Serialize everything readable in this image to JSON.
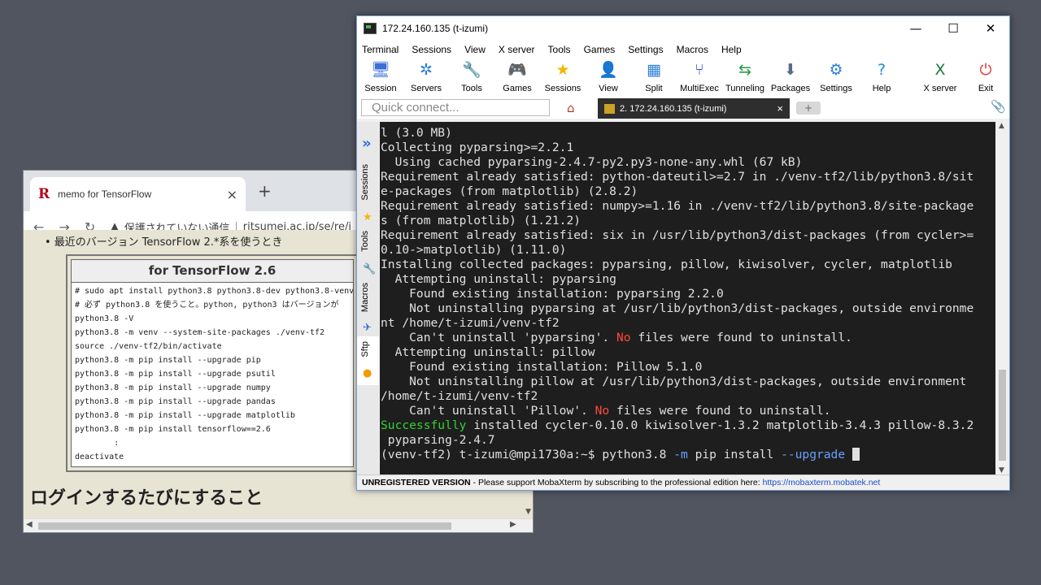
{
  "browser": {
    "tab_title": "memo for TensorFlow",
    "tab_favicon": "R",
    "tab_close": "×",
    "new_tab": "+",
    "nav_back": "←",
    "nav_forward": "→",
    "nav_reload": "↻",
    "insecure_icon": "warning-icon",
    "insecure_label": "保護されていない通信",
    "url": "ritsumei.ac.jp/se/re/i",
    "bullet": "• 最近のバージョン TensorFlow 2.*系を使うとき",
    "code_title": "for TensorFlow 2.6",
    "code_lines": "# sudo apt install python3.8 python3.8-dev python3.8-venv\n# 必ず python3.8 を使うこと。python, python3 はバージョンが\npython3.8 -V\npython3.8 -m venv --system-site-packages ./venv-tf2\nsource ./venv-tf2/bin/activate\npython3.8 -m pip install --upgrade pip\npython3.8 -m pip install --upgrade psutil\npython3.8 -m pip install --upgrade numpy\npython3.8 -m pip install --upgrade pandas\npython3.8 -m pip install --upgrade matplotlib\npython3.8 -m pip install tensorflow==2.6\n        :\ndeactivate",
    "heading": "ログインするたびにすること"
  },
  "moba": {
    "title": "172.24.160.135 (t-izumi)",
    "win_min": "—",
    "win_max": "☐",
    "win_close": "✕",
    "menu": [
      "Terminal",
      "Sessions",
      "View",
      "X server",
      "Tools",
      "Games",
      "Settings",
      "Macros",
      "Help"
    ],
    "toolbar": [
      {
        "label": "Session",
        "icon": "🖥",
        "color": "#3b6fd4"
      },
      {
        "label": "Servers",
        "icon": "✲",
        "color": "#2d7fd4"
      },
      {
        "label": "Tools",
        "icon": "🔧",
        "color": "#d43b3b"
      },
      {
        "label": "Games",
        "icon": "🎮",
        "color": "#666"
      },
      {
        "label": "Sessions",
        "icon": "★",
        "color": "#f2b705"
      },
      {
        "label": "View",
        "icon": "👤",
        "color": "#3b6fd4"
      },
      {
        "label": "Split",
        "icon": "▦",
        "color": "#2d7fd4"
      },
      {
        "label": "MultiExec",
        "icon": "⑂",
        "color": "#3b4fd4"
      },
      {
        "label": "Tunneling",
        "icon": "⇆",
        "color": "#2a9a4a"
      },
      {
        "label": "Packages",
        "icon": "⬇",
        "color": "#5a6a8a"
      },
      {
        "label": "Settings",
        "icon": "⚙",
        "color": "#2d7fd4"
      },
      {
        "label": "Help",
        "icon": "?",
        "color": "#1e88e5"
      },
      {
        "label": "X server",
        "icon": "X",
        "color": "#1e7a3a"
      },
      {
        "label": "Exit",
        "icon": "⏻",
        "color": "#e53935"
      }
    ],
    "quick_connect_placeholder": "Quick connect...",
    "home_icon": "⌂",
    "session_tab": "2. 172.24.160.135 (t-izumi)",
    "session_tab_close": "×",
    "add_tab": "+",
    "clip_icon": "📎",
    "sidebar_arrows": "»",
    "sidebar_tabs": [
      "Sessions",
      "Tools",
      "Macros",
      "Sftp"
    ],
    "sidebar_icons": [
      "★",
      "🔧",
      "✈",
      "●"
    ],
    "terminal": {
      "lines_before_red1": "l (3.0 MB)\nCollecting pyparsing>=2.2.1\n  Using cached pyparsing-2.4.7-py2.py3-none-any.whl (67 kB)\nRequirement already satisfied: python-dateutil>=2.7 in ./venv-tf2/lib/python3.8/sit\ne-packages (from matplotlib) (2.8.2)\nRequirement already satisfied: numpy>=1.16 in ./venv-tf2/lib/python3.8/site-package\ns (from matplotlib) (1.21.2)\nRequirement already satisfied: six in /usr/lib/python3/dist-packages (from cycler>=\n0.10->matplotlib) (1.11.0)\nInstalling collected packages: pyparsing, pillow, kiwisolver, cycler, matplotlib\n  Attempting uninstall: pyparsing\n    Found existing installation: pyparsing 2.2.0\n    Not uninstalling pyparsing at /usr/lib/python3/dist-packages, outside environme\nnt /home/t-izumi/venv-tf2\n    Can't uninstall 'pyparsing'. ",
      "red1": "No",
      "mid_text": " files were found to uninstall.\n  Attempting uninstall: pillow\n    Found existing installation: Pillow 5.1.0\n    Not uninstalling pillow at /usr/lib/python3/dist-packages, outside environment\n/home/t-izumi/venv-tf2\n    Can't uninstall 'Pillow'. ",
      "red2": "No",
      "after_red2": " files were found to uninstall.\n",
      "success_word": "Successfully",
      "success_rest": " installed cycler-0.10.0 kiwisolver-1.3.2 matplotlib-3.4.3 pillow-8.3.2\n pyparsing-2.4.7\n",
      "prompt": "(venv-tf2) t-izumi@mpi1730a:~$ python3.8 ",
      "opt_m": "-m",
      "cmd_mid": " pip install ",
      "opt_upgrade": "--upgrade",
      "trailing": " "
    },
    "status_unregistered": "UNREGISTERED VERSION",
    "status_text": "  -  Please support MobaXterm by subscribing to the professional edition here:  ",
    "status_link": "https://mobaxterm.mobatek.net"
  }
}
